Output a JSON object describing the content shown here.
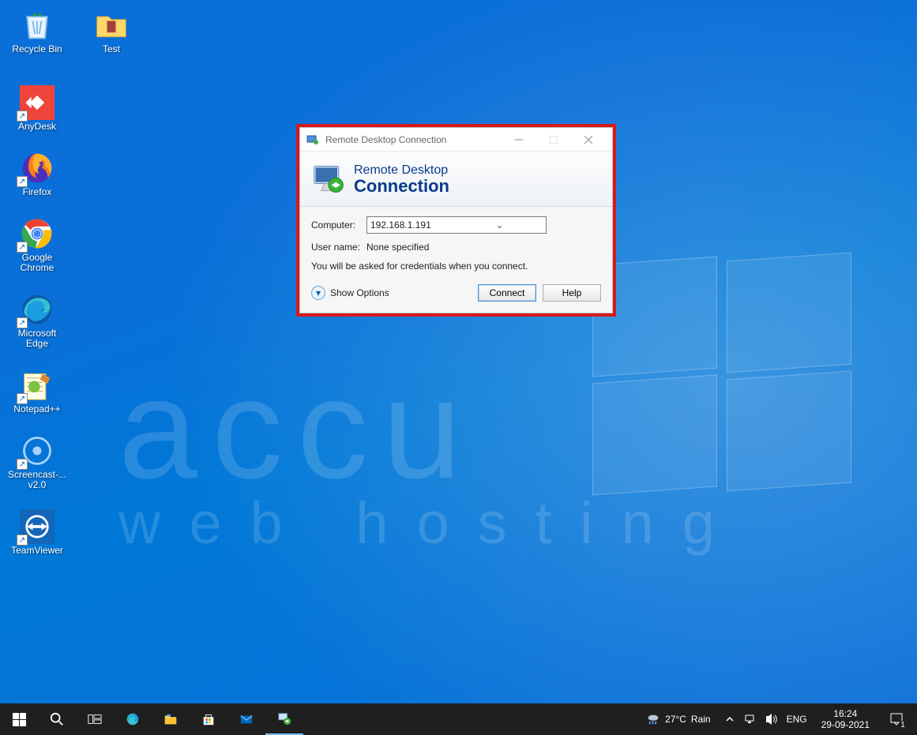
{
  "desktop_icons": {
    "top_row": [
      {
        "label": "Recycle Bin"
      },
      {
        "label": "Test"
      }
    ],
    "column": [
      {
        "label": "AnyDesk"
      },
      {
        "label": "Firefox"
      },
      {
        "label": "Google Chrome"
      },
      {
        "label": "Microsoft Edge"
      },
      {
        "label": "Notepad++"
      },
      {
        "label": "Screencast-... v2.0"
      },
      {
        "label": "TeamViewer"
      }
    ]
  },
  "watermark": {
    "brand": "accu",
    "tagline": "web hosting"
  },
  "rdc": {
    "title": "Remote Desktop Connection",
    "header_line1": "Remote Desktop",
    "header_line2": "Connection",
    "computer_label": "Computer:",
    "computer_value": "192.168.1.191",
    "username_label": "User name:",
    "username_value": "None specified",
    "hint": "You will be asked for credentials when you connect.",
    "show_options": "Show Options",
    "connect": "Connect",
    "help": "Help"
  },
  "taskbar": {
    "weather_temp": "27°C",
    "weather_cond": "Rain",
    "lang": "ENG",
    "time": "16:24",
    "date": "29-09-2021",
    "notification_count": "1"
  }
}
